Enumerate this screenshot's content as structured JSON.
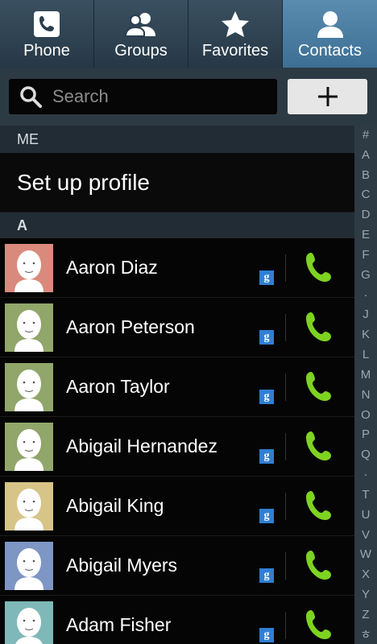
{
  "tabs": [
    {
      "label": "Phone",
      "icon": "phone-icon"
    },
    {
      "label": "Groups",
      "icon": "groups-icon"
    },
    {
      "label": "Favorites",
      "icon": "star-icon"
    },
    {
      "label": "Contacts",
      "icon": "contact-person-icon"
    }
  ],
  "active_tab": "Contacts",
  "search": {
    "placeholder": "Search"
  },
  "sections": {
    "me": "ME",
    "a": "A"
  },
  "profile": {
    "label": "Set up profile"
  },
  "contacts": [
    {
      "name": "Aaron Diaz",
      "avatar_color": "#d98a7c"
    },
    {
      "name": "Aaron Peterson",
      "avatar_color": "#90a66a"
    },
    {
      "name": "Aaron Taylor",
      "avatar_color": "#90a66a"
    },
    {
      "name": "Abigail Hernandez",
      "avatar_color": "#90a66a"
    },
    {
      "name": "Abigail King",
      "avatar_color": "#d6c489"
    },
    {
      "name": "Abigail Myers",
      "avatar_color": "#7e96c4"
    },
    {
      "name": "Adam Fisher",
      "avatar_color": "#7fb8b8"
    }
  ],
  "google_badge": "g",
  "index_letters": [
    "#",
    "A",
    "B",
    "C",
    "D",
    "E",
    "F",
    "G",
    "·",
    "J",
    "K",
    "L",
    "M",
    "N",
    "O",
    "P",
    "Q",
    "·",
    "T",
    "U",
    "V",
    "W",
    "X",
    "Y",
    "Z",
    "ㅎ"
  ],
  "colors": {
    "active_tab": "#4a7ea3",
    "call_green": "#7ed321",
    "google_blue": "#2f7fd3"
  }
}
